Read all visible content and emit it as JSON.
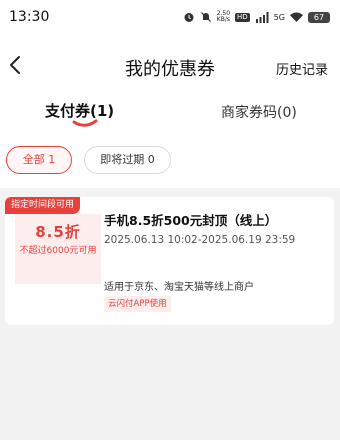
{
  "status_bar": {
    "time": "13:30",
    "network_speed_top": "2.50",
    "network_speed_bottom": "KB/s",
    "hd_label": "HD",
    "network_type": "5G",
    "battery": "67"
  },
  "header": {
    "title": "我的优惠券",
    "history_label": "历史记录"
  },
  "tabs": [
    {
      "label": "支付券(1)",
      "active": true
    },
    {
      "label": "商家券码(0)",
      "active": false
    }
  ],
  "filters": [
    {
      "label": "全部 1",
      "active": true
    },
    {
      "label": "即将过期 0",
      "active": false
    }
  ],
  "coupon": {
    "badge": "指定时间段可用",
    "discount": "8.5折",
    "condition": "不超过6000元可用",
    "title": "手机8.5折500元封顶（线上）",
    "validity": "2025.06.13 10:02-2025.06.19 23:59",
    "scope": "适用于京东、淘宝天猫等线上商户",
    "tag": "云闪付APP使用"
  },
  "colors": {
    "accent": "#e8403c",
    "background": "#f2f2f2",
    "card": "#ffffff"
  }
}
